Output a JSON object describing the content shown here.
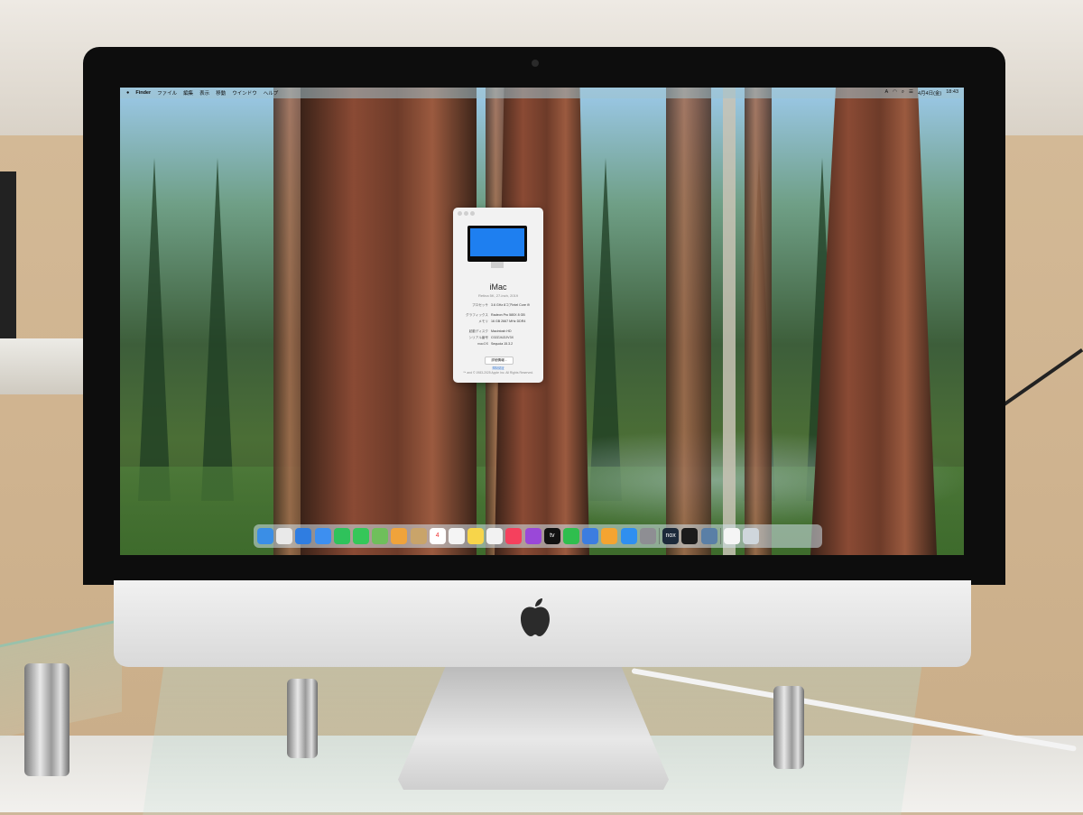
{
  "menubar": {
    "apple": "",
    "items": [
      "Finder",
      "ファイル",
      "編集",
      "表示",
      "移動",
      "ウインドウ",
      "ヘルプ"
    ],
    "status": [
      "A",
      "4月4日(金)",
      "18:43"
    ]
  },
  "about_window": {
    "title": "iMac",
    "subtitle": "Retina 5K, 27-inch, 2019",
    "specs": [
      {
        "k": "プロセッサ",
        "v": "3.6 GHz 8コアIntel Core i9"
      },
      {
        "k": "グラフィックス",
        "v": "Radeon Pro 580X 8 GB"
      },
      {
        "k": "メモリ",
        "v": "16 GB 2667 MHz DDR4"
      },
      {
        "k": "起動ディスク",
        "v": "Macintosh HD"
      },
      {
        "k": "シリアル番号",
        "v": "C02ZJ4J2JV3X"
      },
      {
        "k": "macOS",
        "v": "Sequoia 15.3.2"
      }
    ],
    "more_button": "詳細情報...",
    "footer_link": "規制認証",
    "footer": "™ and © 1983-2025 Apple Inc. All Rights Reserved."
  },
  "dock": {
    "icons": [
      {
        "name": "finder-icon",
        "color": "#3a8ee6"
      },
      {
        "name": "launchpad-icon",
        "color": "#e9e9e9"
      },
      {
        "name": "safari-icon",
        "color": "#2f7de1"
      },
      {
        "name": "mail-icon",
        "color": "#3d8ff0"
      },
      {
        "name": "facetime-icon",
        "color": "#2fc25b"
      },
      {
        "name": "messages-icon",
        "color": "#35c759"
      },
      {
        "name": "maps-icon",
        "color": "#6fbf5b"
      },
      {
        "name": "photos-icon",
        "color": "#f0a33b"
      },
      {
        "name": "contacts-icon",
        "color": "#c9a46a"
      },
      {
        "name": "calendar-icon",
        "color": "#ffffff"
      },
      {
        "name": "reminders-icon",
        "color": "#f4f4f4"
      },
      {
        "name": "notes-icon",
        "color": "#f7d54a"
      },
      {
        "name": "freeform-icon",
        "color": "#f2f2f2"
      },
      {
        "name": "music-icon",
        "color": "#f5405d"
      },
      {
        "name": "podcasts-icon",
        "color": "#9a48d8"
      },
      {
        "name": "tv-icon",
        "color": "#111111"
      },
      {
        "name": "numbers-icon",
        "color": "#2fbe4e"
      },
      {
        "name": "keynote-icon",
        "color": "#3c7de0"
      },
      {
        "name": "pages-icon",
        "color": "#f4a431"
      },
      {
        "name": "appstore-icon",
        "color": "#2f8ff0"
      },
      {
        "name": "settings-icon",
        "color": "#8e8e93"
      },
      {
        "name": "nox-icon",
        "color": "#1c2a3a"
      },
      {
        "name": "terminal-icon",
        "color": "#1b1b1b"
      },
      {
        "name": "screen-app-icon",
        "color": "#5a7fa6"
      },
      {
        "name": "document-icon",
        "color": "#f5f5f5"
      },
      {
        "name": "trash-icon",
        "color": "#cfd6dc"
      }
    ],
    "calendar_day": "4",
    "tv_label": "tv",
    "nox_label": "nox"
  }
}
